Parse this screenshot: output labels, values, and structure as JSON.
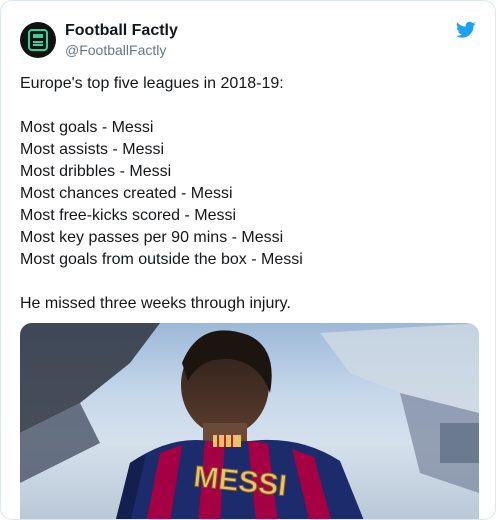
{
  "tweet": {
    "display_name": "Football Factly",
    "handle": "@FootballFactly",
    "lines": [
      "Europe's top five leagues in 2018-19:",
      "Most goals - Messi",
      "Most assists - Messi",
      "Most dribbles - Messi",
      "Most chances created - Messi",
      "Most free-kicks scored - Messi",
      "Most key passes per 90 mins - Messi",
      "Most goals from outside the box - Messi",
      "He missed three weeks through injury."
    ],
    "photo": {
      "jersey_text": "MESSI"
    }
  },
  "icons": {
    "brand": "twitter-bird-icon",
    "avatar": "football-factly-logo"
  },
  "colors": {
    "twitter_blue": "#1da1f2",
    "text": "#14171a",
    "muted": "#657786",
    "jersey_blue": "#1b2b6b",
    "jersey_red": "#a50044",
    "lettering": "#e8c36a"
  }
}
